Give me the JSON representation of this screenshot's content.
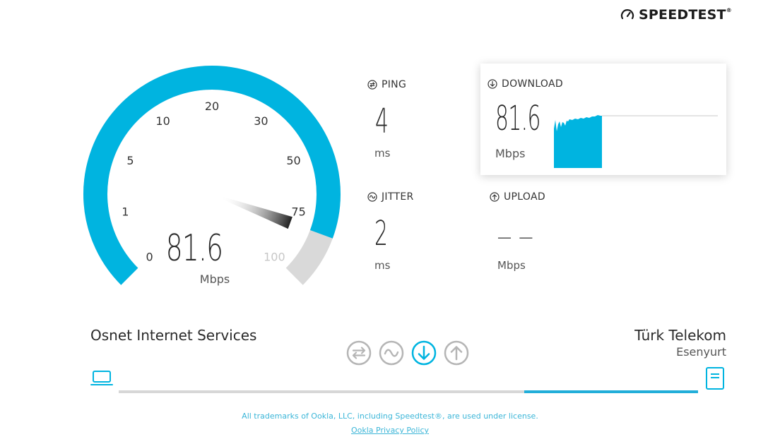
{
  "brand": {
    "name": "SPEEDTEST",
    "trademark": "®",
    "icon": "speedometer-icon"
  },
  "gauge": {
    "value": "81.6",
    "unit": "Mbps",
    "ticks": [
      "0",
      "1",
      "5",
      "10",
      "20",
      "30",
      "50",
      "75",
      "100"
    ],
    "current_mbps": 81.6,
    "colors": {
      "active": "#00b4e0",
      "inactive": "#d9d9d9"
    }
  },
  "ping": {
    "label": "PING",
    "value": "4",
    "unit": "ms",
    "icon": "ping-icon"
  },
  "jitter": {
    "label": "JITTER",
    "value": "2",
    "unit": "ms",
    "icon": "jitter-icon"
  },
  "download": {
    "label": "DOWNLOAD",
    "value": "81.6",
    "unit": "Mbps",
    "icon": "download-icon"
  },
  "upload": {
    "label": "UPLOAD",
    "value": "— —",
    "unit": "Mbps",
    "icon": "upload-icon"
  },
  "connection": {
    "isp": "Osnet Internet Services",
    "server_name": "Türk Telekom",
    "server_location": "Esenyurt",
    "client_icon": "laptop-icon",
    "server_icon": "server-icon",
    "progress": 0.3
  },
  "steps": [
    "ping-step-icon",
    "jitter-step-icon",
    "download-step-icon",
    "upload-step-icon"
  ],
  "footer": {
    "trademark_text": "All trademarks of Ookla, LLC, including Speedtest®, are used under license.",
    "privacy_link": "Ookla Privacy Policy"
  },
  "colors": {
    "accent": "#00b4e0",
    "muted": "#aaaaaa"
  }
}
